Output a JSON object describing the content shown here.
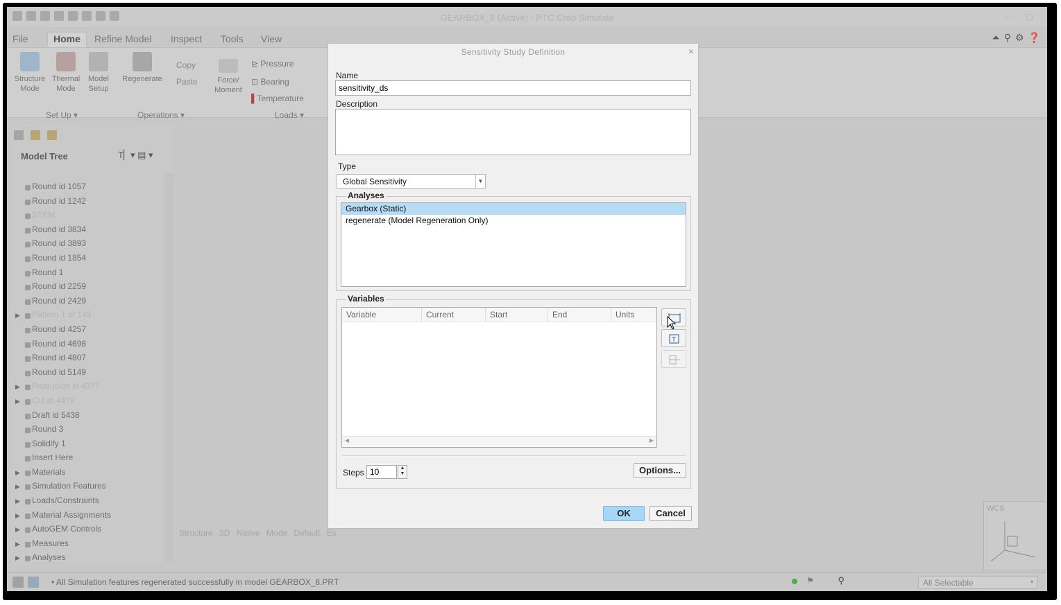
{
  "app": {
    "window_title": "GEARBOX_8 (Active) - PTC Creo Simulate",
    "tabs": [
      "File",
      "Home",
      "Refine Model",
      "Inspect",
      "Tools",
      "View"
    ],
    "active_tab": "Home",
    "ribbon": {
      "structure_mode": "Structure Mode",
      "thermal_mode": "Thermal Mode",
      "model_setup": "Model Setup",
      "regenerate": "Regenerate",
      "copy": "Copy",
      "paste": "Paste",
      "force_moment": "Force/ Moment",
      "pressure": "Pressure",
      "bearing": "Bearing",
      "temperature": "Temperature",
      "group_setup": "Set Up",
      "group_operations": "Operations",
      "group_loads": "Loads"
    },
    "model_tree": {
      "title": "Model Tree",
      "items": [
        {
          "label": "Round id 1057",
          "faded": false,
          "expandable": false
        },
        {
          "label": "Round id 1242",
          "faded": false,
          "expandable": false
        },
        {
          "label": "STEM",
          "faded": true,
          "expandable": false
        },
        {
          "label": "Round id 3834",
          "faded": false,
          "expandable": false
        },
        {
          "label": "Round id 3893",
          "faded": false,
          "expandable": false
        },
        {
          "label": "Round id 1854",
          "faded": false,
          "expandable": false
        },
        {
          "label": "Round 1",
          "faded": false,
          "expandable": false
        },
        {
          "label": "Round id 2259",
          "faded": false,
          "expandable": false
        },
        {
          "label": "Round id 2429",
          "faded": false,
          "expandable": false
        },
        {
          "label": "Pattern 1 of 148",
          "faded": true,
          "expandable": true
        },
        {
          "label": "Round id 4257",
          "faded": false,
          "expandable": false
        },
        {
          "label": "Round id 4698",
          "faded": false,
          "expandable": false
        },
        {
          "label": "Round id 4807",
          "faded": false,
          "expandable": false
        },
        {
          "label": "Round id 5149",
          "faded": false,
          "expandable": false
        },
        {
          "label": "Protrusion id 4377",
          "faded": true,
          "expandable": true
        },
        {
          "label": "Cut id 4479",
          "faded": true,
          "expandable": true
        },
        {
          "label": "Draft id 5438",
          "faded": false,
          "expandable": false
        },
        {
          "label": "Round 3",
          "faded": false,
          "expandable": false
        },
        {
          "label": "Solidify 1",
          "faded": false,
          "expandable": false
        },
        {
          "label": "Insert Here",
          "faded": false,
          "expandable": false
        },
        {
          "label": "Materials",
          "faded": false,
          "expandable": true
        },
        {
          "label": "Simulation Features",
          "faded": false,
          "expandable": true
        },
        {
          "label": "Loads/Constraints",
          "faded": false,
          "expandable": true
        },
        {
          "label": "Material Assignments",
          "faded": false,
          "expandable": true
        },
        {
          "label": "AutoGEM Controls",
          "faded": false,
          "expandable": true
        },
        {
          "label": "Measures",
          "faded": false,
          "expandable": true
        },
        {
          "label": "Analyses",
          "faded": false,
          "expandable": true
        }
      ]
    },
    "graphics_bar": "Structure 3D Native Mode Default Ex",
    "wcs": "WCS",
    "status_message": "• All Simulation features regenerated successfully in model GEARBOX_8.PRT",
    "filter": "All Selectable"
  },
  "dialog": {
    "title": "Sensitivity Study Definition",
    "name_label": "Name",
    "name_value": "sensitivity_ds",
    "description_label": "Description",
    "description_value": "",
    "type_label": "Type",
    "type_value": "Global Sensitivity",
    "analyses_label": "Analyses",
    "analyses": [
      {
        "label": "Gearbox (Static)",
        "selected": true
      },
      {
        "label": "regenerate (Model Regeneration Only)",
        "selected": false
      }
    ],
    "variables_label": "Variables",
    "columns": [
      "Variable",
      "Current",
      "Start",
      "End",
      "Units"
    ],
    "steps_label": "Steps",
    "steps_value": "10",
    "options_label": "Options...",
    "ok_label": "OK",
    "cancel_label": "Cancel"
  }
}
